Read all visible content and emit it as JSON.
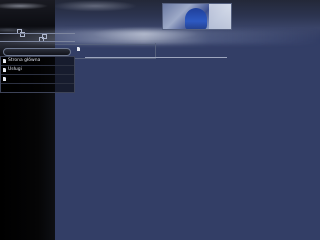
{
  "header": {
    "title_text": "",
    "photo_caption": ""
  },
  "nav": {
    "items": [
      {
        "label": "Strona główna",
        "icon": "page-icon"
      },
      {
        "label": "Usługi",
        "icon": "page-icon"
      },
      {
        "label": "",
        "icon": "page-icon"
      }
    ]
  },
  "content": {
    "page_icon": "page-icon"
  },
  "colors": {
    "background": "#333e66",
    "sidebar": "#000000",
    "nav_text": "#dfe3ee"
  }
}
